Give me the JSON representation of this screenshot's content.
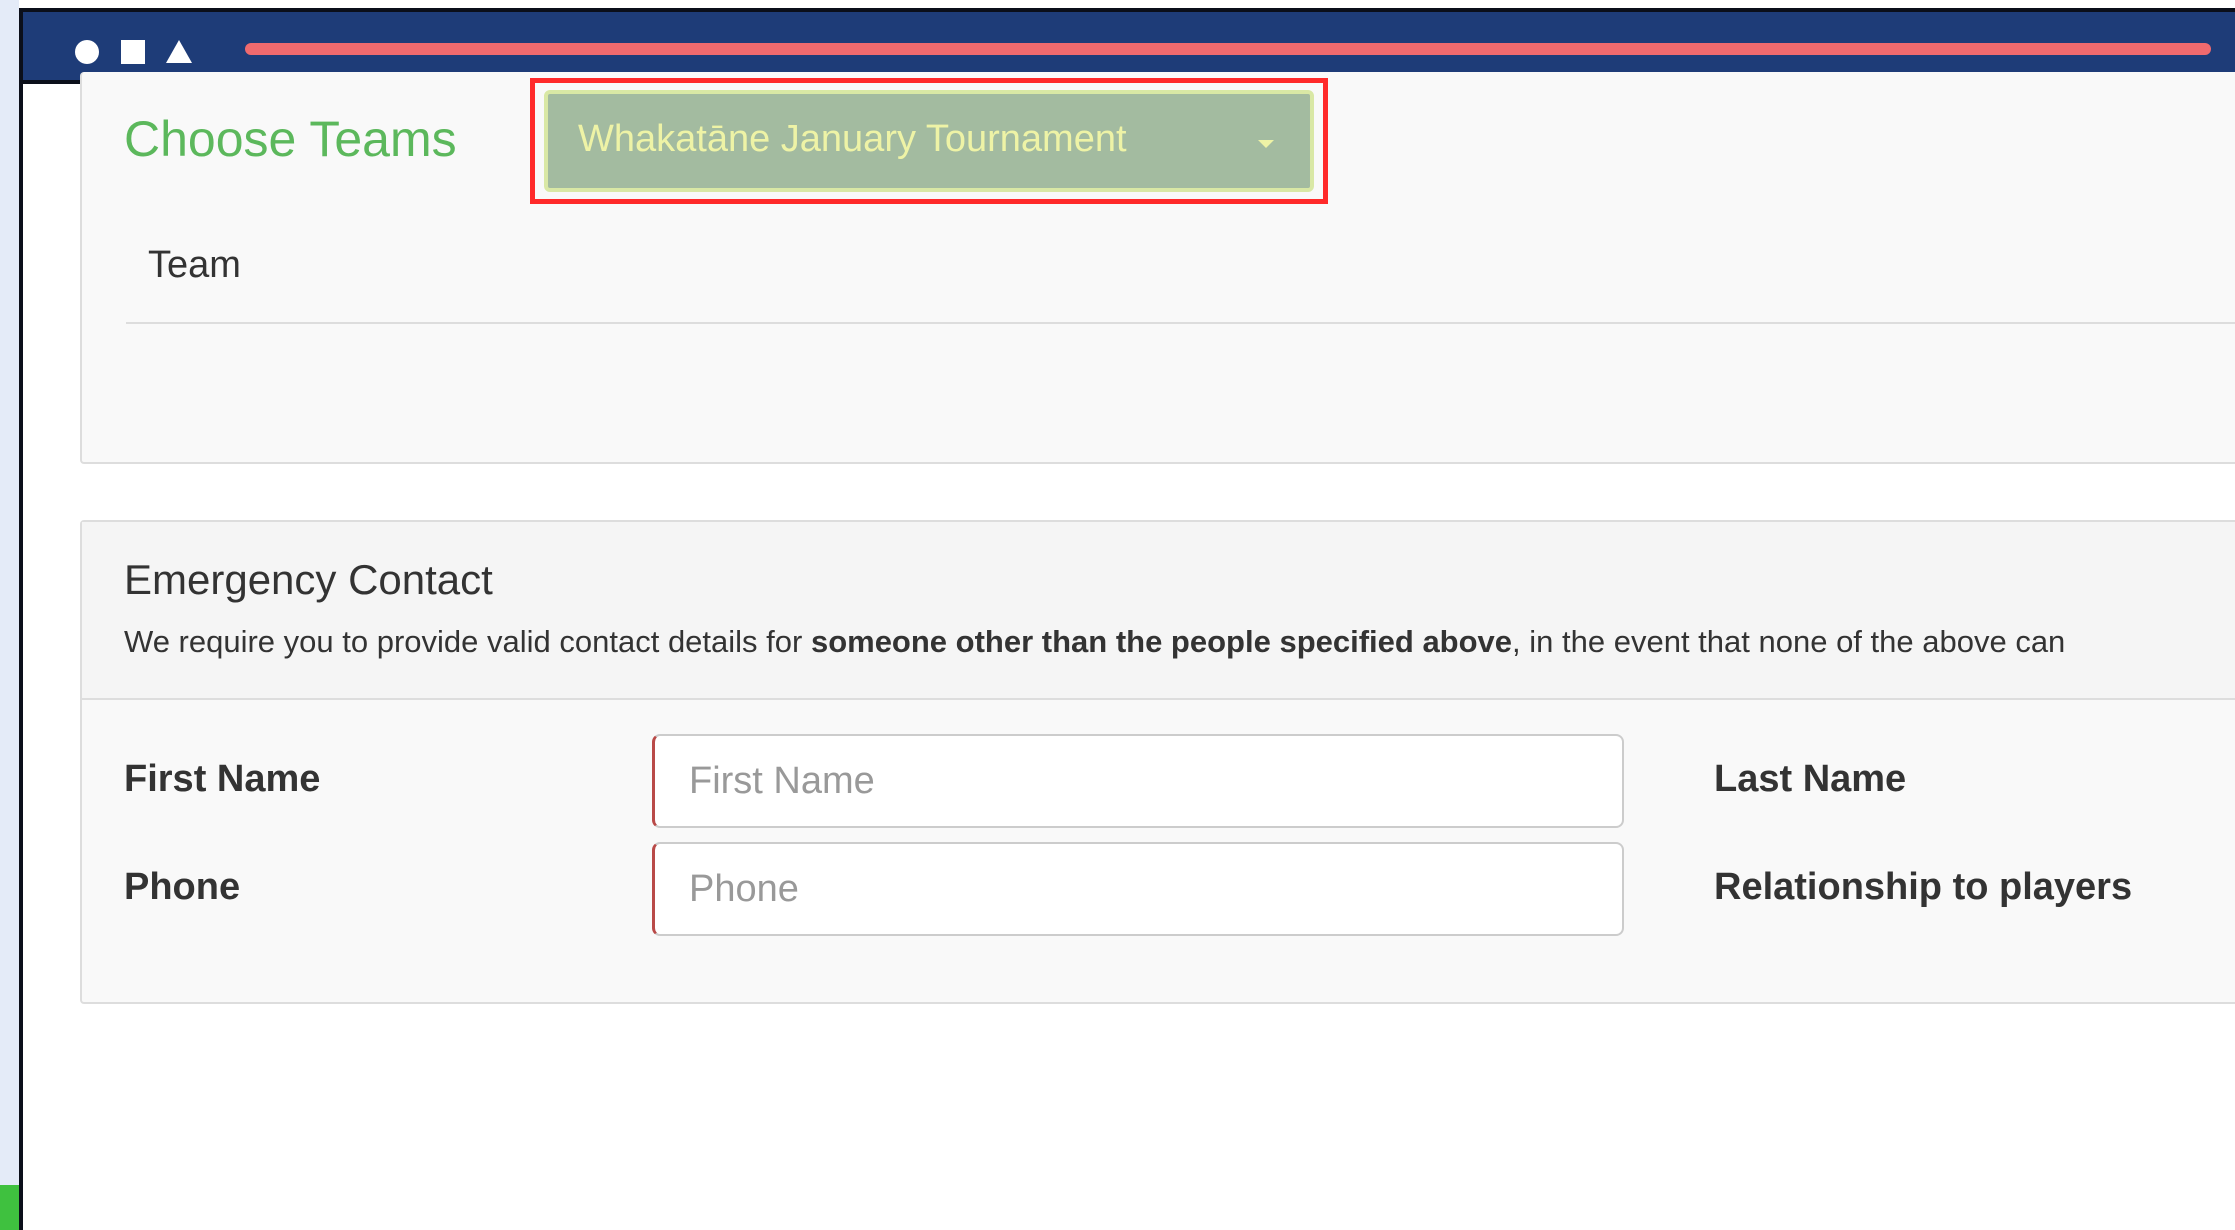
{
  "progress": {
    "fill_percent": 100,
    "track_color": "#1e3c78",
    "fill_color": "#ef6a6e"
  },
  "window_controls": [
    "circle-icon",
    "square-icon",
    "triangle-icon"
  ],
  "choose_teams": {
    "title": "Choose Teams",
    "tournament_selected": "Whakatāne January Tournament",
    "column_team": "Team"
  },
  "emergency_contact": {
    "title": "Emergency Contact",
    "description_prefix": "We require you to provide valid contact details for ",
    "description_bold": "someone other than the people specified above",
    "description_suffix": ", in the event that none of the above can",
    "first_name_label": "First Name",
    "first_name_placeholder": "First Name",
    "phone_label": "Phone",
    "phone_placeholder": "Phone",
    "last_name_label": "Last Name",
    "relationship_label": "Relationship to players"
  },
  "colors": {
    "accent_green": "#5cb85c",
    "highlight_red": "#ff2a2a",
    "select_bg": "#a3bba0",
    "select_text": "#eef3a6",
    "header_bar": "#1e3c78"
  }
}
